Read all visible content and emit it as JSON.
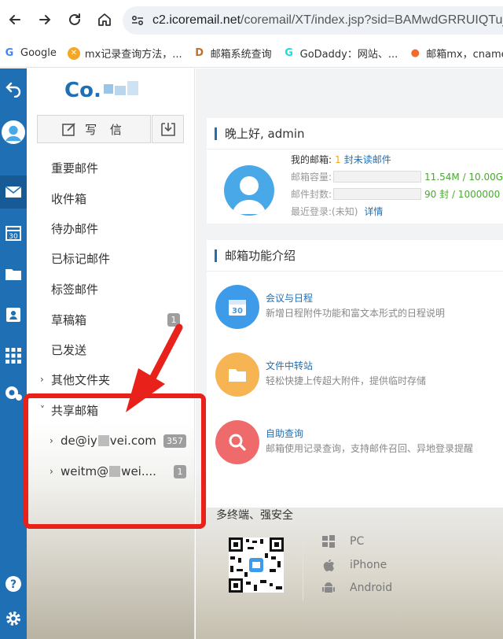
{
  "browser": {
    "url_host": "c2.icoremail.net",
    "url_path": "/coremail/XT/index.jsp?sid=BAMwdGRRUIQTujB",
    "bookmarks": [
      {
        "label": "Google",
        "icon": "google-icon"
      },
      {
        "label": "mx记录查询方法，...",
        "icon": "mx-icon"
      },
      {
        "label": "邮箱系统查询",
        "icon": "d-icon"
      },
      {
        "label": "GoDaddy：网站、...",
        "icon": "godaddy-icon"
      },
      {
        "label": "邮箱mx，cname",
        "icon": "apple-icon"
      }
    ]
  },
  "sidebar": {
    "compose_label": "写 信",
    "folders": [
      {
        "label": "重要邮件"
      },
      {
        "label": "收件箱"
      },
      {
        "label": "待办邮件"
      },
      {
        "label": "已标记邮件"
      },
      {
        "label": "标签邮件"
      },
      {
        "label": "草稿箱",
        "badge": "1"
      },
      {
        "label": "已发送"
      },
      {
        "label": "其他文件夹"
      },
      {
        "label": "共享邮箱"
      }
    ],
    "shared": [
      {
        "prefix": "de@iy",
        "suffix": "vei.com",
        "badge": "357"
      },
      {
        "prefix": "weitm@",
        "suffix": "wei....",
        "badge": "1"
      }
    ]
  },
  "greeting": {
    "title": "晚上好, admin",
    "my_mailbox_label": "我的邮箱:",
    "unread_count": "1",
    "unread_text": "封未读邮件",
    "capacity_label": "邮箱容量:",
    "capacity_value": "11.54M / 10.00G",
    "count_label": "邮件封数:",
    "count_value": "90 封 / 1000000",
    "last_login_label": "最近登录:",
    "last_login_value": "(未知)",
    "details_link": "详情"
  },
  "features": {
    "title": "邮箱功能介绍",
    "items": [
      {
        "title": "会议与日程",
        "desc": "新增日程附件功能和富文本形式的日程说明",
        "color": "#3d9be9",
        "icon": "calendar-icon"
      },
      {
        "title": "文件中转站",
        "desc": "轻松快捷上传超大附件，提供临时存储",
        "color": "#f6b552",
        "icon": "folder-icon"
      },
      {
        "title": "自助查询",
        "desc": "邮箱使用记录查询，支持邮件召回、异地登录提醒",
        "color": "#ef6b6b",
        "icon": "search-icon"
      }
    ],
    "multi_title": "多终端、强安全",
    "platforms": [
      {
        "label": "PC",
        "icon": "windows-icon"
      },
      {
        "label": "iPhone",
        "icon": "apple-icon"
      },
      {
        "label": "Android",
        "icon": "android-icon"
      }
    ]
  },
  "colors": {
    "rail": "#1f6fb5",
    "accent": "#1f6fb5",
    "annotation": "#e8211b",
    "green": "#4aa832",
    "orange": "#f5a623"
  }
}
